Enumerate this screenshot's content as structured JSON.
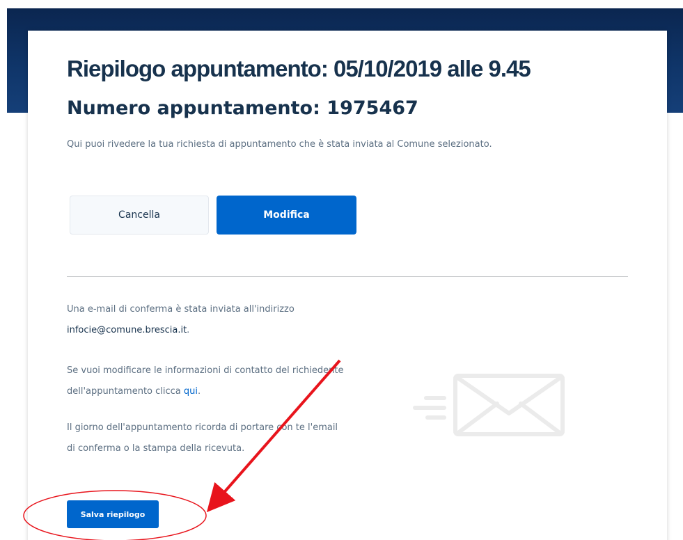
{
  "summary": {
    "title": "Riepilogo appuntamento: 05/10/2019 alle 9.45",
    "appointment_number": "Numero appuntamento: 1975467",
    "intro": "Qui puoi rivedere la tua richiesta di appuntamento che è stata inviata al Comune selezionato."
  },
  "actions": {
    "cancel_label": "Cancella",
    "modify_label": "Modifica",
    "save_label": "Salva riepilogo"
  },
  "confirmation": {
    "email_text": "Una e-mail di conferma è stata inviata all'indirizzo",
    "email_address": "infocie@comune.brescia.it",
    "email_period": ".",
    "contact_text": "Se vuoi modificare le informazioni di contatto del richiedente dell'appuntamento clicca",
    "contact_link": "qui",
    "contact_period": ".",
    "reminder_text": "Il giorno dell'appuntamento ricorda di portare con te l'email di conferma o la stampa della ricevuta."
  },
  "icons": {
    "mail": "mail-icon"
  },
  "colors": {
    "primary": "#0066cc",
    "header_band": "#0f3569",
    "title_text": "#17324d",
    "body_text": "#5c6f82",
    "annotation": "#e8141c"
  }
}
